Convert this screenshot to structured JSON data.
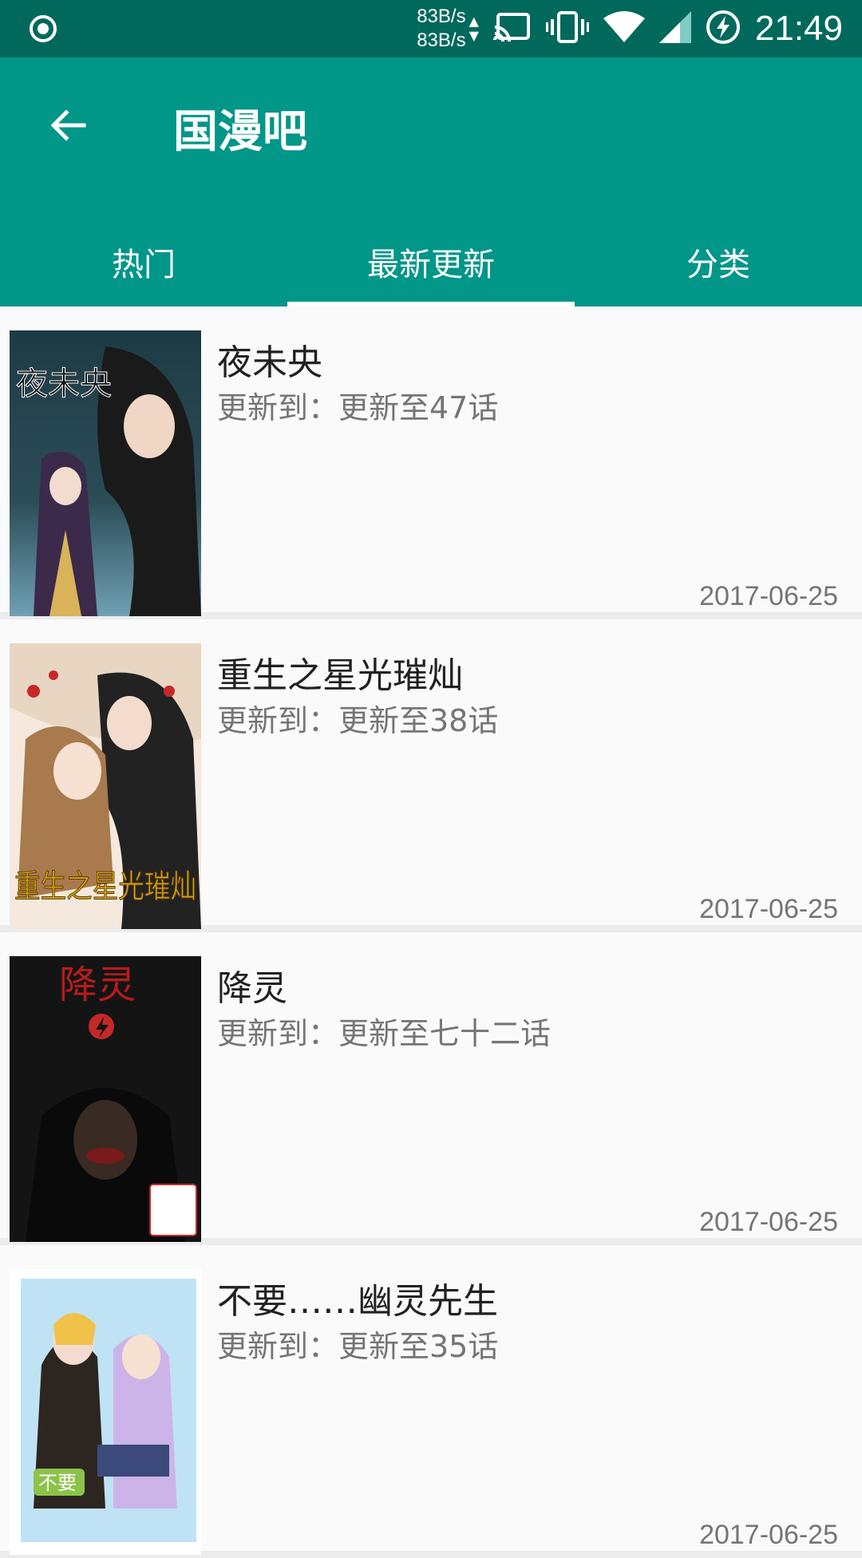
{
  "status_bar": {
    "net_up": "83B/s",
    "net_down": "83B/s",
    "time": "21:49"
  },
  "app_bar": {
    "title": "国漫吧",
    "tabs": [
      {
        "label": "热门",
        "active": false
      },
      {
        "label": "最新更新",
        "active": true
      },
      {
        "label": "分类",
        "active": false
      }
    ]
  },
  "comics": [
    {
      "title": "夜未央",
      "update": "更新到：更新至47话",
      "date": "2017-06-25",
      "cover_text": "夜未央"
    },
    {
      "title": "重生之星光璀灿",
      "update": "更新到：更新至38话",
      "date": "2017-06-25",
      "cover_text": "重生之星光璀灿"
    },
    {
      "title": "降灵",
      "update": "更新到：更新至七十二话",
      "date": "2017-06-25",
      "cover_text": "降灵"
    },
    {
      "title": "不要……幽灵先生",
      "update": "更新到：更新至35话",
      "date": "2017-06-25",
      "cover_text": "不要"
    }
  ],
  "colors": {
    "status_bar": "#00695c",
    "primary": "#009688",
    "background": "#fafafa",
    "divider": "#ececec"
  }
}
